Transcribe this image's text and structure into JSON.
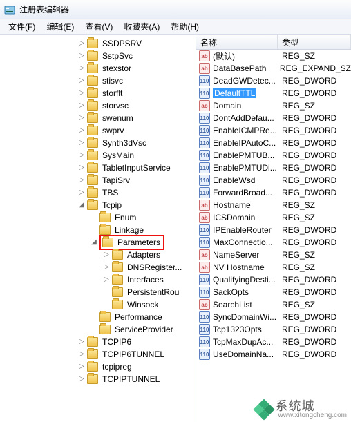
{
  "window": {
    "title": "注册表编辑器"
  },
  "menu": {
    "file": "文件(F)",
    "edit": "编辑(E)",
    "view": "查看(V)",
    "favorites": "收藏夹(A)",
    "help": "帮助(H)"
  },
  "tree": {
    "level1": [
      {
        "label": "SSDPSRV",
        "exp": "c"
      },
      {
        "label": "SstpSvc",
        "exp": "c"
      },
      {
        "label": "stexstor",
        "exp": "c"
      },
      {
        "label": "stisvc",
        "exp": "c"
      },
      {
        "label": "storflt",
        "exp": "c"
      },
      {
        "label": "storvsc",
        "exp": "c"
      },
      {
        "label": "swenum",
        "exp": "c"
      },
      {
        "label": "swprv",
        "exp": "c"
      },
      {
        "label": "Synth3dVsc",
        "exp": "c"
      },
      {
        "label": "SysMain",
        "exp": "c"
      },
      {
        "label": "TabletInputService",
        "exp": "c"
      },
      {
        "label": "TapiSrv",
        "exp": "c"
      },
      {
        "label": "TBS",
        "exp": "c"
      },
      {
        "label": "Tcpip",
        "exp": "o",
        "children": "tcpip"
      },
      {
        "label": "TCPIP6",
        "exp": "c"
      },
      {
        "label": "TCPIP6TUNNEL",
        "exp": "c"
      },
      {
        "label": "tcpipreg",
        "exp": "c"
      },
      {
        "label": "TCPIPTUNNEL",
        "exp": "c"
      }
    ],
    "tcpip": [
      {
        "label": "Enum",
        "exp": "n"
      },
      {
        "label": "Linkage",
        "exp": "n"
      },
      {
        "label": "Parameters",
        "exp": "o",
        "children": "params",
        "highlight": true
      },
      {
        "label": "Performance",
        "exp": "n"
      },
      {
        "label": "ServiceProvider",
        "exp": "n"
      }
    ],
    "params": [
      {
        "label": "Adapters",
        "exp": "c"
      },
      {
        "label": "DNSRegister...",
        "exp": "c"
      },
      {
        "label": "Interfaces",
        "exp": "c"
      },
      {
        "label": "PersistentRou",
        "exp": "n"
      },
      {
        "label": "Winsock",
        "exp": "n"
      }
    ]
  },
  "columns": {
    "name": "名称",
    "type": "类型"
  },
  "values": [
    {
      "name": "(默认)",
      "type": "REG_SZ",
      "icon": "sz"
    },
    {
      "name": "DataBasePath",
      "type": "REG_EXPAND_SZ",
      "icon": "sz"
    },
    {
      "name": "DeadGWDetec...",
      "type": "REG_DWORD",
      "icon": "dw"
    },
    {
      "name": "DefaultTTL",
      "type": "REG_DWORD",
      "icon": "dw",
      "selected": true
    },
    {
      "name": "Domain",
      "type": "REG_SZ",
      "icon": "sz"
    },
    {
      "name": "DontAddDefau...",
      "type": "REG_DWORD",
      "icon": "dw"
    },
    {
      "name": "EnableICMPRe...",
      "type": "REG_DWORD",
      "icon": "dw"
    },
    {
      "name": "EnableIPAutoC...",
      "type": "REG_DWORD",
      "icon": "dw"
    },
    {
      "name": "EnablePMTUB...",
      "type": "REG_DWORD",
      "icon": "dw"
    },
    {
      "name": "EnablePMTUDi...",
      "type": "REG_DWORD",
      "icon": "dw"
    },
    {
      "name": "EnableWsd",
      "type": "REG_DWORD",
      "icon": "dw"
    },
    {
      "name": "ForwardBroad...",
      "type": "REG_DWORD",
      "icon": "dw"
    },
    {
      "name": "Hostname",
      "type": "REG_SZ",
      "icon": "sz"
    },
    {
      "name": "ICSDomain",
      "type": "REG_SZ",
      "icon": "sz"
    },
    {
      "name": "IPEnableRouter",
      "type": "REG_DWORD",
      "icon": "dw"
    },
    {
      "name": "MaxConnectio...",
      "type": "REG_DWORD",
      "icon": "dw"
    },
    {
      "name": "NameServer",
      "type": "REG_SZ",
      "icon": "sz"
    },
    {
      "name": "NV Hostname",
      "type": "REG_SZ",
      "icon": "sz"
    },
    {
      "name": "QualifyingDesti...",
      "type": "REG_DWORD",
      "icon": "dw"
    },
    {
      "name": "SackOpts",
      "type": "REG_DWORD",
      "icon": "dw"
    },
    {
      "name": "SearchList",
      "type": "REG_SZ",
      "icon": "sz"
    },
    {
      "name": "SyncDomainWi...",
      "type": "REG_DWORD",
      "icon": "dw"
    },
    {
      "name": "Tcp1323Opts",
      "type": "REG_DWORD",
      "icon": "dw"
    },
    {
      "name": "TcpMaxDupAc...",
      "type": "REG_DWORD",
      "icon": "dw"
    },
    {
      "name": "UseDomainNa...",
      "type": "REG_DWORD",
      "icon": "dw"
    }
  ],
  "watermark": {
    "brand": "系统城",
    "url": "www.xitongcheng.com"
  },
  "icon_text": {
    "sz": "ab",
    "dw": "110"
  }
}
